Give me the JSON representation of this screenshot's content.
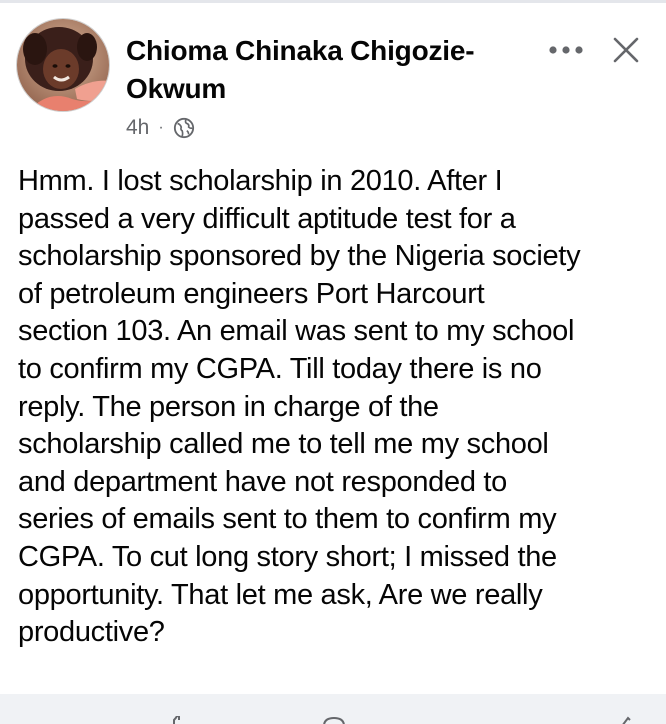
{
  "post": {
    "author_name": "Chioma Chinaka Chigozie-Okwum",
    "timestamp": "4h",
    "separator": "·",
    "audience_icon": "globe-icon",
    "more_icon": "more-horizontal-icon",
    "close_icon": "close-icon",
    "avatar_icon": "profile-photo",
    "body": "Hmm. I lost scholarship in 2010. After I\npassed a very difficult aptitude test for a\nscholarship sponsored by the Nigeria society\nof petroleum engineers Port Harcourt\nsection 103. An email was sent to my school\nto confirm my CGPA. Till today there is no\nreply. The person in charge of the\nscholarship called me to tell me my school\nand department have not responded to\nseries of emails sent to them to confirm my\nCGPA. To cut long story short; I missed the\nopportunity. That let me ask, Are we really\nproductive?"
  },
  "colors": {
    "text_primary": "#050505",
    "text_secondary": "#65676b",
    "divider": "#f0f2f5"
  }
}
